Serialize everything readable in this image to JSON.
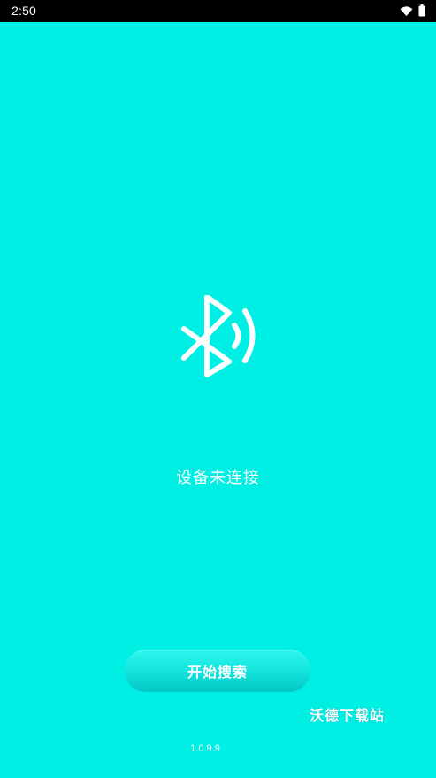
{
  "status_bar": {
    "time": "2:50",
    "icons": [
      "wifi-icon",
      "battery-icon"
    ]
  },
  "main": {
    "status_text": "设备未连接",
    "start_button_label": "开始搜索",
    "watermark": "沃德下载站",
    "version": "1.0.9.9",
    "bluetooth_icon": "bluetooth-icon"
  },
  "colors": {
    "background": "#00EFE5",
    "status_bar": "#000000",
    "button_top": "#2EF7EE",
    "button_bottom": "#04C6C4",
    "text": "#FFFFFF"
  }
}
